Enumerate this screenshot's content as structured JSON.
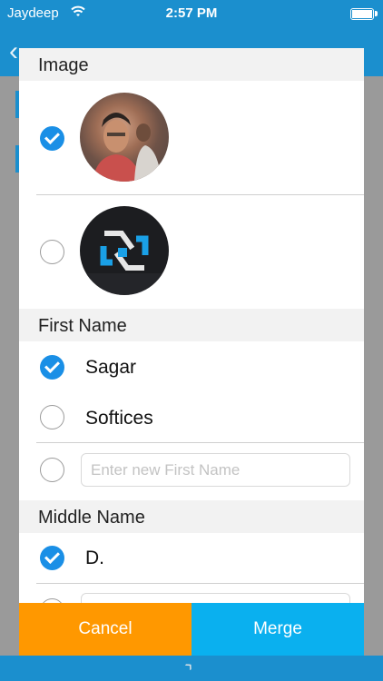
{
  "status_bar": {
    "carrier": "Jaydeep",
    "time": "2:57 PM"
  },
  "dialog": {
    "sections": {
      "image": {
        "header": "Image"
      },
      "first_name": {
        "header": "First Name",
        "options": [
          "Sagar",
          "Softices"
        ],
        "new_placeholder": "Enter new First Name"
      },
      "middle_name": {
        "header": "Middle Name",
        "options": [
          "D."
        ]
      }
    },
    "buttons": {
      "cancel": "Cancel",
      "merge": "Merge"
    }
  },
  "colors": {
    "accent_blue": "#1a8fe6",
    "cancel_orange": "#ff9800",
    "merge_blue": "#0ab0ef",
    "nav_blue": "#1b8fce"
  }
}
